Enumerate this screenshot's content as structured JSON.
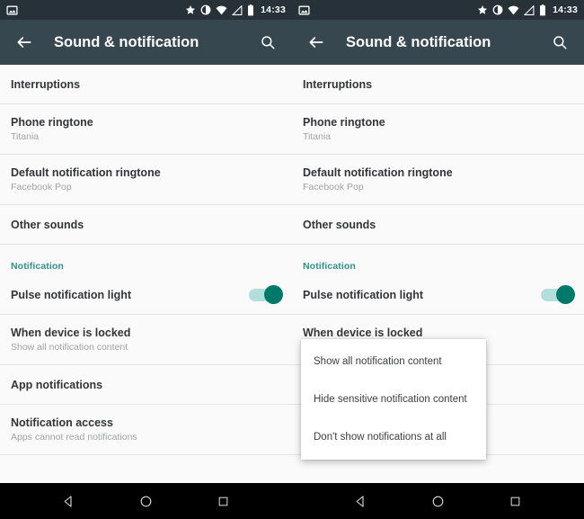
{
  "status_bar": {
    "notification_icon": "image-icon",
    "icons": [
      "star-icon",
      "brightness-icon",
      "wifi-icon",
      "signal-icon",
      "battery-icon"
    ],
    "time": "14:33"
  },
  "toolbar": {
    "back_icon": "back-arrow-icon",
    "title": "Sound & notification",
    "search_icon": "search-icon"
  },
  "settings_list": [
    {
      "title": "Interruptions",
      "subtitle": ""
    },
    {
      "title": "Phone ringtone",
      "subtitle": "Titania"
    },
    {
      "title": "Default notification ringtone",
      "subtitle": "Facebook Pop"
    },
    {
      "title": "Other sounds",
      "subtitle": ""
    }
  ],
  "notification_section": {
    "header": "Notification",
    "pulse_light": {
      "title": "Pulse notification light",
      "toggle_on": true
    },
    "when_locked": {
      "title": "When device is locked",
      "subtitle": "Show all notification content"
    },
    "app_notifications": {
      "title": "App notifications",
      "subtitle": ""
    },
    "notification_access": {
      "title": "Notification access",
      "subtitle": "Apps cannot read notifications"
    }
  },
  "dropdown": {
    "options": [
      "Show all notification content",
      "Hide sensitive notification content",
      "Don't show notifications at all"
    ]
  },
  "nav_bar": {
    "back": "back-triangle-icon",
    "home": "home-circle-icon",
    "recents": "recents-square-icon"
  },
  "colors": {
    "status_bar": "#263238",
    "toolbar": "#37474f",
    "accent_teal": "#2e9387",
    "switch_thumb": "#00796b",
    "switch_track": "#b2dfdb",
    "list_bg": "#fafafa",
    "nav_bg": "#000000"
  }
}
